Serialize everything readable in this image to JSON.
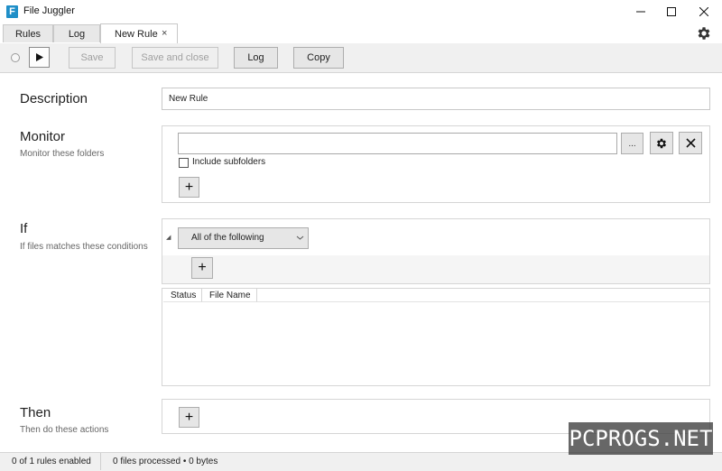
{
  "window": {
    "title": "File Juggler",
    "icon_letter": "F"
  },
  "tabs": [
    {
      "label": "Rules"
    },
    {
      "label": "Log"
    },
    {
      "label": "New Rule",
      "close": "×"
    }
  ],
  "toolbar": {
    "run_icon": "play-icon",
    "save_label": "Save",
    "save_close_label": "Save and close",
    "log_label": "Log",
    "copy_label": "Copy"
  },
  "description": {
    "title": "Description",
    "value": "New Rule"
  },
  "monitor": {
    "title": "Monitor",
    "subtitle": "Monitor these folders",
    "folder_value": "",
    "browse_label": "...",
    "include_subfolders_label": "Include subfolders",
    "include_subfolders_checked": false,
    "add_label": "+"
  },
  "if_section": {
    "title": "If",
    "subtitle": "If files matches these conditions",
    "dropdown_value": "All of the following",
    "add_label": "+"
  },
  "file_table": {
    "columns": [
      "Status",
      "File Name"
    ],
    "rows": []
  },
  "then": {
    "title": "Then",
    "subtitle": "Then do these actions",
    "add_label": "+"
  },
  "statusbar": {
    "rules": "0 of 1 rules enabled",
    "files": "0 files processed • 0 bytes"
  },
  "watermark": {
    "text": "PCPROGS.NET"
  },
  "colors": {
    "accent": "#1f8fc8",
    "toolbar_bg": "#f0f0f0",
    "border": "#d5d5d5"
  }
}
